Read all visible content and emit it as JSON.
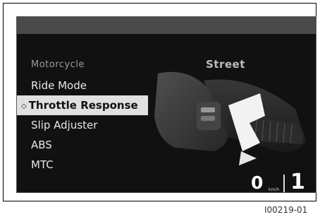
{
  "menu": {
    "header_label": "Motorcycle",
    "header_value": "Street",
    "items": [
      {
        "label": "Ride Mode",
        "selected": false
      },
      {
        "label": "Throttle Response",
        "selected": true,
        "marker": "◇"
      },
      {
        "label": "Slip Adjuster",
        "selected": false
      },
      {
        "label": "ABS",
        "selected": false
      },
      {
        "label": "MTC",
        "selected": false
      }
    ]
  },
  "status": {
    "speed": "0",
    "speed_unit": "km/h",
    "gear": "1"
  },
  "figure_id": "I00219-01",
  "icons": [
    "throttle-grip-icon",
    "rotation-arrow-icon"
  ]
}
